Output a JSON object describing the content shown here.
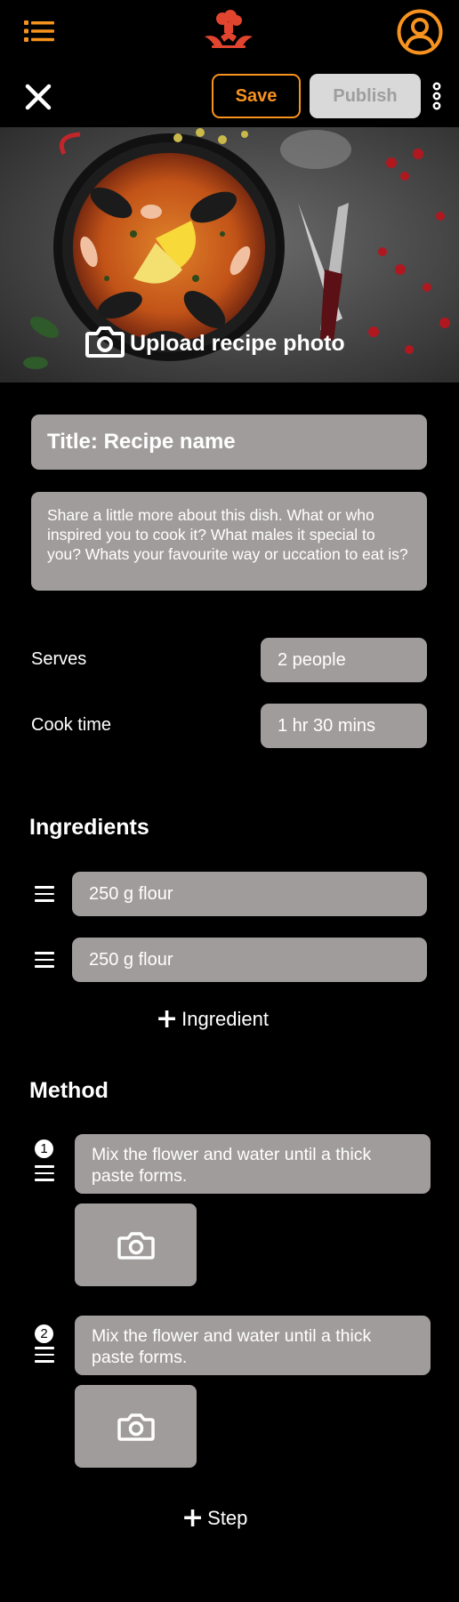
{
  "colors": {
    "accent": "#f7931e",
    "field": "#a19c9c",
    "background": "#000000"
  },
  "topbar": {
    "menu_icon": "list-icon",
    "logo_icon": "chef-logo-icon",
    "profile_icon": "user-circle-icon"
  },
  "actionbar": {
    "close_icon": "close-icon",
    "save_label": "Save",
    "publish_label": "Publish",
    "more_icon": "more-vertical-icon"
  },
  "hero": {
    "upload_label": "Upload recipe photo",
    "camera_icon": "camera-icon"
  },
  "title_field": {
    "value": "Title: Recipe name"
  },
  "description_field": {
    "placeholder": "Share a little more about this dish. What or who inspired you to cook it? What males it special to you? Whats your favourite way or uccation to eat is?"
  },
  "serves": {
    "label": "Serves",
    "value": "2 people"
  },
  "cook_time": {
    "label": "Cook time",
    "value": "1 hr 30 mins"
  },
  "ingredients": {
    "heading": "Ingredients",
    "items": [
      {
        "value": "250 g flour"
      },
      {
        "value": "250 g flour"
      }
    ],
    "add_label": "Ingredient"
  },
  "method": {
    "heading": "Method",
    "steps": [
      {
        "number": "1",
        "text": "Mix the flower and water until a thick paste forms."
      },
      {
        "number": "2",
        "text": "Mix the flower and water until a thick paste forms."
      }
    ],
    "add_label": "Step"
  }
}
